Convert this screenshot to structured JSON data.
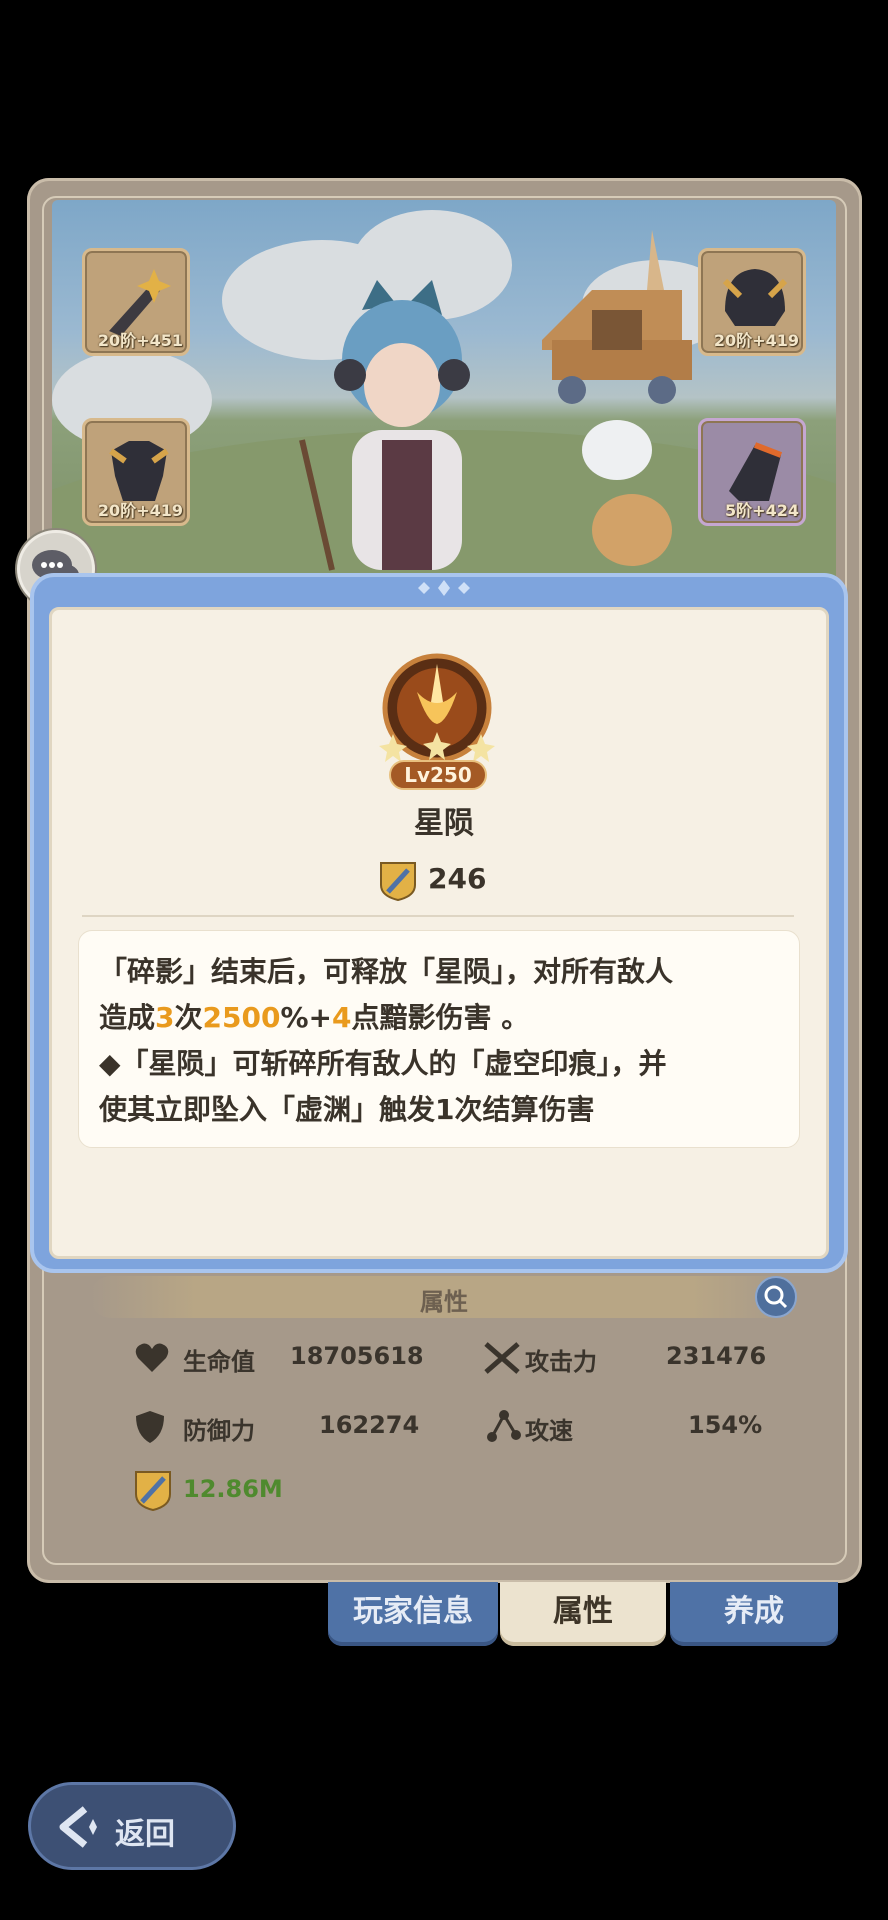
{
  "equipment": [
    {
      "slot": "weapon",
      "level": "20阶+451",
      "icon": "sword-icon"
    },
    {
      "slot": "helmet",
      "level": "20阶+419",
      "icon": "helmet-icon"
    },
    {
      "slot": "armor",
      "level": "20阶+419",
      "icon": "armor-icon"
    },
    {
      "slot": "accessory",
      "level": "5阶+424",
      "icon": "gauntlet-icon",
      "rarity_color": "#c5a7d1"
    }
  ],
  "skill": {
    "level": "Lv250",
    "name": "星陨",
    "power": "246",
    "desc_line1": "「碎影」结束后，可释放「星陨」，对所有敌人",
    "desc_line2_pre": "造成",
    "desc_line2_hits": "3",
    "desc_line2_mid": "次",
    "desc_line2_pct": "2500",
    "desc_line2_plus": "%+",
    "desc_line2_extra": "4",
    "desc_line2_post": "点黯影伤害 。",
    "desc_line3": "◆「星陨」可斩碎所有敌人的「虚空印痕」，并",
    "desc_line4": "使其立即坠入「虚渊」触发1次结算伤害",
    "highlight_color": "#e99a1d"
  },
  "attributes": {
    "title": "属性",
    "hp_label": "生命值",
    "hp_value": "18705618",
    "atk_label": "攻击力",
    "atk_value": "231476",
    "def_label": "防御力",
    "def_value": "162274",
    "spd_label": "攻速",
    "spd_value": "154%",
    "power_value": "12.86M",
    "power_color": "#4f8a2e"
  },
  "tabs": {
    "player_info": "玩家信息",
    "attributes": "属性",
    "training": "养成"
  },
  "back_label": "返回"
}
